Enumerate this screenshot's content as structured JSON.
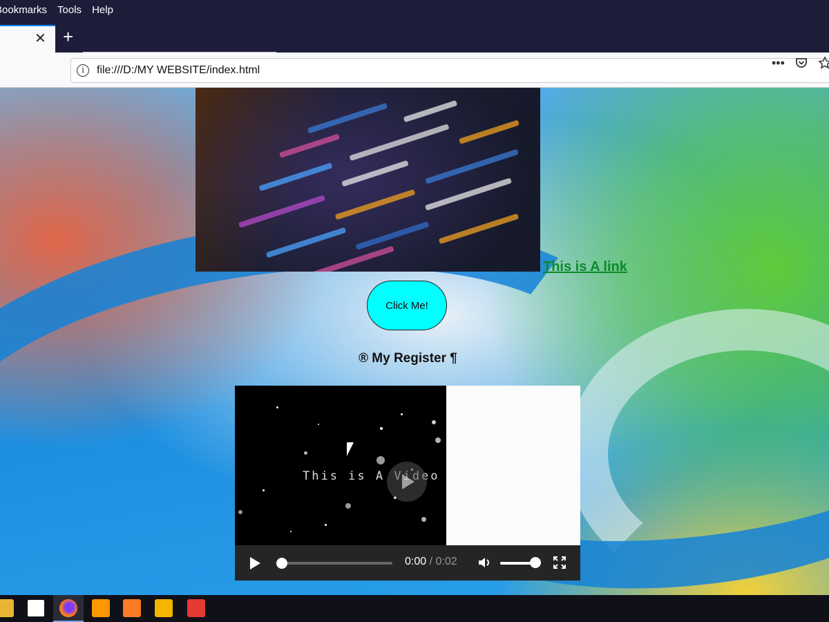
{
  "menu": {
    "items": [
      "Bookmarks",
      "Tools",
      "Help"
    ]
  },
  "tabs": {
    "close_symbol": "✕",
    "new_tab_symbol": "+"
  },
  "address_bar": {
    "url": "file:///D:/MY WEBSITE/index.html",
    "info_symbol": "i",
    "more_symbol": "•••"
  },
  "page": {
    "link_text": "This is A link",
    "button_label": "Click Me!",
    "register_text": "® My Register ¶",
    "video": {
      "overlay_text": "This is A Video",
      "current_time": "0:00",
      "separator": "/",
      "duration": "0:02",
      "progress": 0,
      "volume": 1.0
    }
  },
  "colors": {
    "link": "#0c8a2a",
    "button": "#00ffff",
    "tab_accent": "#0a84ff"
  },
  "taskbar": {
    "icons": [
      "file-explorer-icon",
      "store-icon",
      "firefox-icon",
      "sublime-text-icon",
      "xampp-icon",
      "app-icon",
      "red-app-icon"
    ]
  }
}
